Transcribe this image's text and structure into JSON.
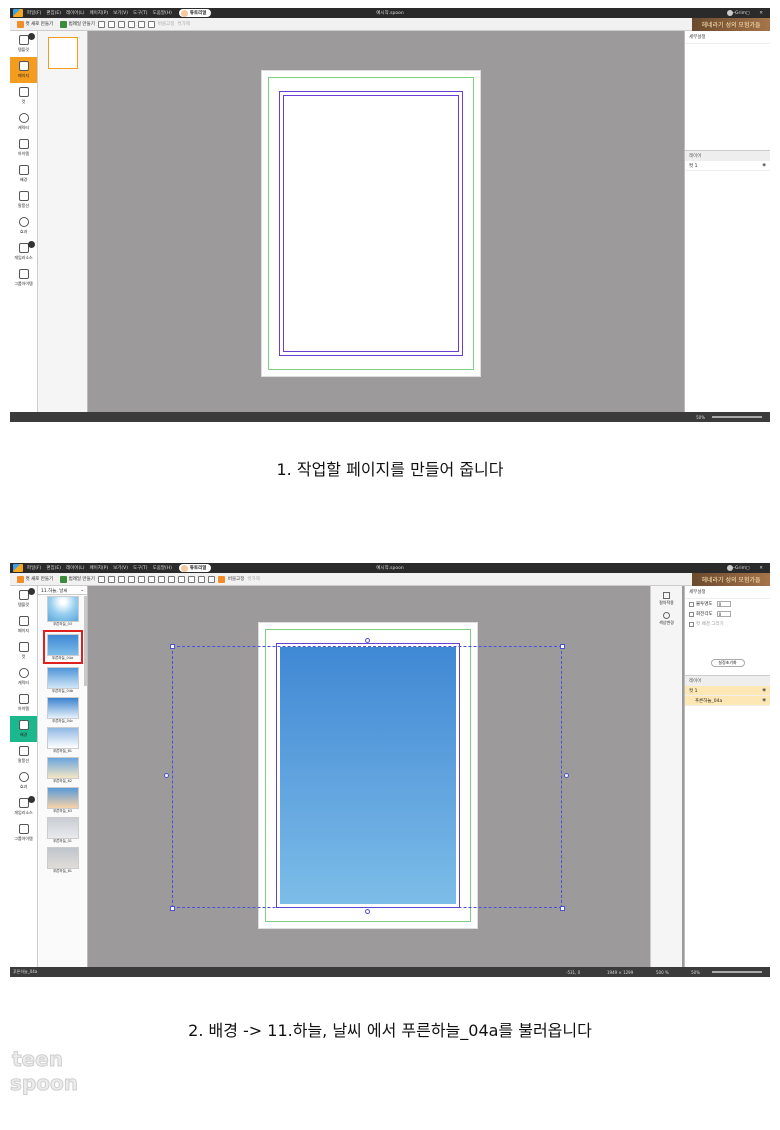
{
  "shot1": {
    "title": {
      "menus": [
        "파일(F)",
        "편집(E)",
        "레이어(L)",
        "페이지(P)",
        "보기(V)",
        "도구(T)",
        "도움말(H)"
      ],
      "tutorial": "튜토리얼",
      "document": "예시작.spoon",
      "user": "Grim",
      "win": "— ▢ ✕"
    },
    "toolbar": {
      "new_cut": "컷 새로 만들기",
      "make_frame": "범례일 만들기",
      "fix": "버블고정",
      "dim2": "컷가제"
    },
    "banner": "헤네라기 성의 모험가들",
    "left_items": [
      "템플릿",
      "페이지",
      "컷",
      "캐릭터",
      "아이템",
      "배경",
      "말풍선",
      "효과",
      "개임리소스",
      "그룹아이템"
    ],
    "right": {
      "settings": "세부설정",
      "layers": "레이어",
      "layer1": "컷 1"
    },
    "status": {
      "zoom": "50%"
    }
  },
  "caption1": "1. 작업할 페이지를 만들어 줍니다",
  "shot2": {
    "title": {
      "menus": [
        "파일(F)",
        "편집(E)",
        "레이어(L)",
        "페이지(P)",
        "보기(V)",
        "도구(T)",
        "도움말(H)"
      ],
      "tutorial": "튜토리얼",
      "document": "예시작.spoon",
      "user": "Grim",
      "win": "— ▢ ✕"
    },
    "toolbar": {
      "new_cut": "컷 새로 만들기",
      "make_frame": "범례일 만들기",
      "fix": "버블고정",
      "dim2": "컷가제"
    },
    "banner": "헤네라기 성의 모험가들",
    "folder": "11.하늘, 날씨",
    "thumbs": [
      "푸른하늘_03",
      "푸른하늘_04a",
      "푸른하늘_04b",
      "푸른하늘_04c",
      "푸른하늘_61",
      "푸른하늘_62",
      "푸른하늘_63",
      "푸른하늘_01",
      "푸른하늘_61"
    ],
    "left_items": [
      "템플릿",
      "페이지",
      "컷",
      "캐릭터",
      "아이템",
      "배경",
      "말풍선",
      "효과",
      "개임리소스",
      "그룹아이템"
    ],
    "sidestrip": [
      "절차적용",
      "색상변경"
    ],
    "right": {
      "settings": "세부설정",
      "opacity": "불투명도",
      "opacity_val": "0",
      "rotate": "회전각도",
      "rotate_val": "0",
      "bg_draw": "컷 배경 그리기",
      "reset": "설정초기화",
      "layers": "레이어",
      "layer1": "컷 1",
      "layer2": "푸른하늘_04a"
    },
    "status": {
      "file": "푸른하늘_04a",
      "coords": "-531, 0",
      "size": "1949 × 1299",
      "zoom_doc": "500 %",
      "zoom": "50%"
    }
  },
  "caption2": "2. 배경 -> 11.하늘, 날씨 에서 푸른하늘_04a를 불러옵니다",
  "watermark": "teen spoon",
  "colors": {
    "accent_orange": "#f39c1f",
    "accent_green": "#1bb78d",
    "selection": "#4a52d8",
    "sky_top": "#3f88d4",
    "sky_bottom": "#7cbde8"
  }
}
